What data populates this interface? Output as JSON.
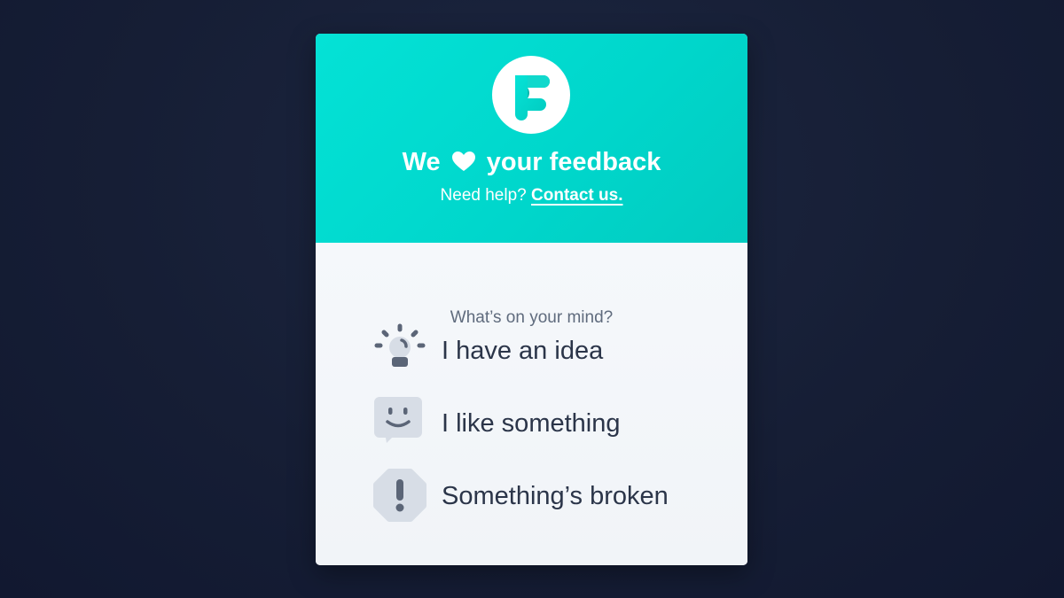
{
  "header": {
    "headline_before": "We",
    "headline_after": "your feedback",
    "heart_icon": "heart-icon",
    "help_text": "Need help?",
    "contact_link": "Contact us.",
    "logo_icon": "brand-f-logo-icon"
  },
  "body": {
    "prompt": "What’s on your mind?",
    "options": [
      {
        "label": "I have an idea",
        "icon": "lightbulb-icon"
      },
      {
        "label": "I like something",
        "icon": "smiley-chat-icon"
      },
      {
        "label": "Something’s broken",
        "icon": "exclamation-octagon-icon"
      }
    ]
  },
  "colors": {
    "background": "#161e35",
    "header_teal": "#00d6cb",
    "card_body": "#f3f6fa",
    "text_dark": "#2b3549",
    "text_muted": "#5f6b7d",
    "icon_gray": "#d7dde6",
    "icon_dark": "#5b6577"
  }
}
